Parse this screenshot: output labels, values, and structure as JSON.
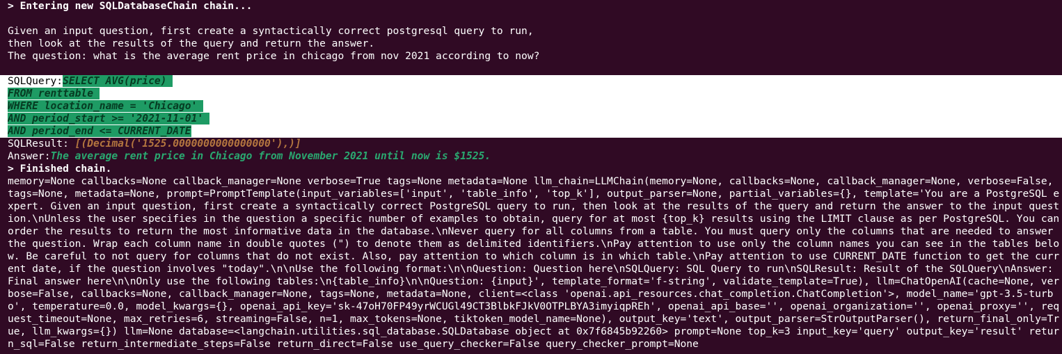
{
  "terminal": {
    "entering": "> Entering new SQLDatabaseChain chain...",
    "prompt_lines": [
      "Given an input question, first create a syntactically correct postgresql query to run,",
      "then look at the results of the query and return the answer.",
      "The question: what is the average rent price in chicago from nov 2021 according to now?"
    ],
    "sql_label": "SQLQuery:",
    "sql_lines": [
      "SELECT AVG(price) ",
      "FROM renttable ",
      "WHERE location_name = 'Chicago' ",
      "AND period_start >= '2021-11-01' ",
      "AND period_end <= CURRENT_DATE"
    ],
    "result_label": "SQLResult: ",
    "result_value": "[(Decimal('1525.0000000000000000'),)]",
    "answer_label": "Answer:",
    "answer_value": "The average rent price in Chicago from November 2021 until now is $1525.",
    "finished": "> Finished chain.",
    "dump": "memory=None callbacks=None callback_manager=None verbose=True tags=None metadata=None llm_chain=LLMChain(memory=None, callbacks=None, callback_manager=None, verbose=False, tags=None, metadata=None, prompt=PromptTemplate(input_variables=['input', 'table_info', 'top_k'], output_parser=None, partial_variables={}, template='You are a PostgreSQL expert. Given an input question, first create a syntactically correct PostgreSQL query to run, then look at the results of the query and return the answer to the input question.\\nUnless the user specifies in the question a specific number of examples to obtain, query for at most {top_k} results using the LIMIT clause as per PostgreSQL. You can order the results to return the most informative data in the database.\\nNever query for all columns from a table. You must query only the columns that are needed to answer the question. Wrap each column name in double quotes (\") to denote them as delimited identifiers.\\nPay attention to use only the column names you can see in the tables below. Be careful to not query for columns that do not exist. Also, pay attention to which column is in which table.\\nPay attention to use CURRENT_DATE function to get the current date, if the question involves \"today\".\\n\\nUse the following format:\\n\\nQuestion: Question here\\nSQLQuery: SQL Query to run\\nSQLResult: Result of the SQLQuery\\nAnswer: Final answer here\\n\\nOnly use the following tables:\\n{table_info}\\n\\nQuestion: {input}', template_format='f-string', validate_template=True), llm=ChatOpenAI(cache=None, verbose=False, callbacks=None, callback_manager=None, tags=None, metadata=None, client=<class 'openai.api_resources.chat_completion.ChatCompletion'>, model_name='gpt-3.5-turbo', temperature=0.0, model_kwargs={}, openai_api_key='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', openai_api_base='', openai_organization='', openai_proxy='', request_timeout=None, max_retries=6, streaming=False, n=1, max_tokens=None, tiktoken_model_name=None), output_key='text', output_parser=StrOutputParser(), return_final_only=True, llm_kwargs={}) llm=None database=<langchain.utilities.sql_database.SQLDatabase object at 0x7f6845b92260> prompt=None top_k=3 input_key='query' output_key='result' return_sql=False return_intermediate_steps=False return_direct=False use_query_checker=False query_checker_prompt=None"
  },
  "colors": {
    "background": "#300a24",
    "highlight_bg": "#1e9b64",
    "result": "#b4763f",
    "answer": "#2aa870"
  }
}
